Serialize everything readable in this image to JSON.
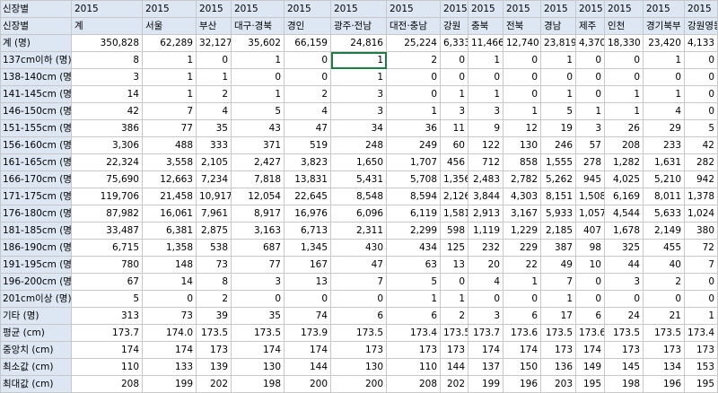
{
  "sheet": {
    "corner_labels": [
      "신장별",
      "신장별"
    ],
    "year_row": [
      "2015",
      "2015",
      "2015",
      "2015",
      "2015",
      "2015",
      "2015",
      "2015",
      "2015",
      "2015",
      "2015",
      "2015",
      "2015",
      "2015",
      "2015"
    ],
    "region_row": [
      "계",
      "서울",
      "부산",
      "대구·경북",
      "경인",
      "광주·전남",
      "대전·충남",
      "강원",
      "충북",
      "전북",
      "경남",
      "제주",
      "인천",
      "경기북부",
      "강원영동"
    ],
    "rows": [
      {
        "label": "계 (명)",
        "values": [
          "350,828",
          "62,289",
          "32,127",
          "35,602",
          "66,159",
          "24,816",
          "25,224",
          "6,333",
          "11,466",
          "12,740",
          "23,819",
          "4,370",
          "18,330",
          "23,420",
          "4,133"
        ]
      },
      {
        "label": "137cm이하 (명)",
        "values": [
          "8",
          "1",
          "0",
          "1",
          "0",
          "1",
          "2",
          "0",
          "1",
          "0",
          "1",
          "0",
          "0",
          "1",
          "0"
        ]
      },
      {
        "label": "138-140cm (명)",
        "values": [
          "3",
          "1",
          "1",
          "0",
          "0",
          "1",
          "0",
          "0",
          "0",
          "0",
          "0",
          "0",
          "0",
          "0",
          "0"
        ]
      },
      {
        "label": "141-145cm (명)",
        "values": [
          "14",
          "1",
          "2",
          "1",
          "2",
          "3",
          "0",
          "1",
          "1",
          "0",
          "1",
          "0",
          "1",
          "1",
          "0"
        ]
      },
      {
        "label": "146-150cm (명)",
        "values": [
          "42",
          "7",
          "4",
          "5",
          "4",
          "3",
          "1",
          "3",
          "3",
          "1",
          "5",
          "1",
          "1",
          "4",
          "0"
        ]
      },
      {
        "label": "151-155cm (명)",
        "values": [
          "386",
          "77",
          "35",
          "43",
          "47",
          "34",
          "36",
          "11",
          "9",
          "12",
          "19",
          "3",
          "26",
          "29",
          "5"
        ]
      },
      {
        "label": "156-160cm (명)",
        "values": [
          "3,306",
          "488",
          "333",
          "371",
          "519",
          "248",
          "249",
          "60",
          "122",
          "130",
          "246",
          "57",
          "208",
          "233",
          "42"
        ]
      },
      {
        "label": "161-165cm (명)",
        "values": [
          "22,324",
          "3,558",
          "2,105",
          "2,427",
          "3,823",
          "1,650",
          "1,707",
          "456",
          "712",
          "858",
          "1,555",
          "278",
          "1,282",
          "1,631",
          "282"
        ]
      },
      {
        "label": "166-170cm (명)",
        "values": [
          "75,690",
          "12,663",
          "7,234",
          "7,818",
          "13,831",
          "5,431",
          "5,708",
          "1,356",
          "2,483",
          "2,782",
          "5,262",
          "945",
          "4,025",
          "5,210",
          "942"
        ]
      },
      {
        "label": "171-175cm (명)",
        "values": [
          "119,706",
          "21,458",
          "10,917",
          "12,054",
          "22,645",
          "8,548",
          "8,594",
          "2,126",
          "3,844",
          "4,303",
          "8,151",
          "1,508",
          "6,169",
          "8,011",
          "1,378"
        ]
      },
      {
        "label": "176-180cm (명)",
        "values": [
          "87,982",
          "16,061",
          "7,961",
          "8,917",
          "16,976",
          "6,096",
          "6,119",
          "1,581",
          "2,913",
          "3,167",
          "5,933",
          "1,057",
          "4,544",
          "5,633",
          "1,024"
        ]
      },
      {
        "label": "181-185cm (명)",
        "values": [
          "33,487",
          "6,381",
          "2,875",
          "3,163",
          "6,713",
          "2,311",
          "2,299",
          "598",
          "1,119",
          "1,229",
          "2,185",
          "407",
          "1,678",
          "2,149",
          "380"
        ]
      },
      {
        "label": "186-190cm (명)",
        "values": [
          "6,715",
          "1,358",
          "538",
          "687",
          "1,345",
          "430",
          "434",
          "125",
          "232",
          "229",
          "387",
          "98",
          "325",
          "455",
          "72"
        ]
      },
      {
        "label": "191-195cm (명)",
        "values": [
          "780",
          "148",
          "73",
          "77",
          "167",
          "47",
          "63",
          "13",
          "20",
          "22",
          "49",
          "10",
          "44",
          "40",
          "7"
        ]
      },
      {
        "label": "196-200cm (명)",
        "values": [
          "67",
          "14",
          "8",
          "3",
          "13",
          "7",
          "5",
          "0",
          "4",
          "1",
          "7",
          "0",
          "3",
          "2",
          "0"
        ]
      },
      {
        "label": "201cm이상 (명)",
        "values": [
          "5",
          "0",
          "2",
          "0",
          "0",
          "0",
          "1",
          "1",
          "0",
          "0",
          "1",
          "0",
          "0",
          "0",
          "0"
        ]
      },
      {
        "label": "기타 (명)",
        "values": [
          "313",
          "73",
          "39",
          "35",
          "74",
          "6",
          "6",
          "2",
          "3",
          "6",
          "17",
          "6",
          "24",
          "21",
          "1"
        ]
      },
      {
        "label": "평균 (cm)",
        "values": [
          "173.7",
          "174.0",
          "173.5",
          "173.5",
          "173.9",
          "173.5",
          "173.4",
          "173.5",
          "173.7",
          "173.6",
          "173.5",
          "173.6",
          "173.5",
          "173.5",
          "173.4"
        ]
      },
      {
        "label": "중앙치 (cm)",
        "values": [
          "174",
          "174",
          "173",
          "174",
          "174",
          "173",
          "173",
          "173",
          "174",
          "174",
          "173",
          "174",
          "173",
          "173",
          "173"
        ]
      },
      {
        "label": "최소값 (cm)",
        "values": [
          "110",
          "133",
          "139",
          "130",
          "144",
          "130",
          "110",
          "144",
          "137",
          "150",
          "136",
          "149",
          "145",
          "134",
          "153"
        ]
      },
      {
        "label": "최대값 (cm)",
        "values": [
          "208",
          "199",
          "202",
          "198",
          "200",
          "200",
          "208",
          "202",
          "199",
          "196",
          "203",
          "195",
          "198",
          "196",
          "195"
        ]
      }
    ]
  }
}
